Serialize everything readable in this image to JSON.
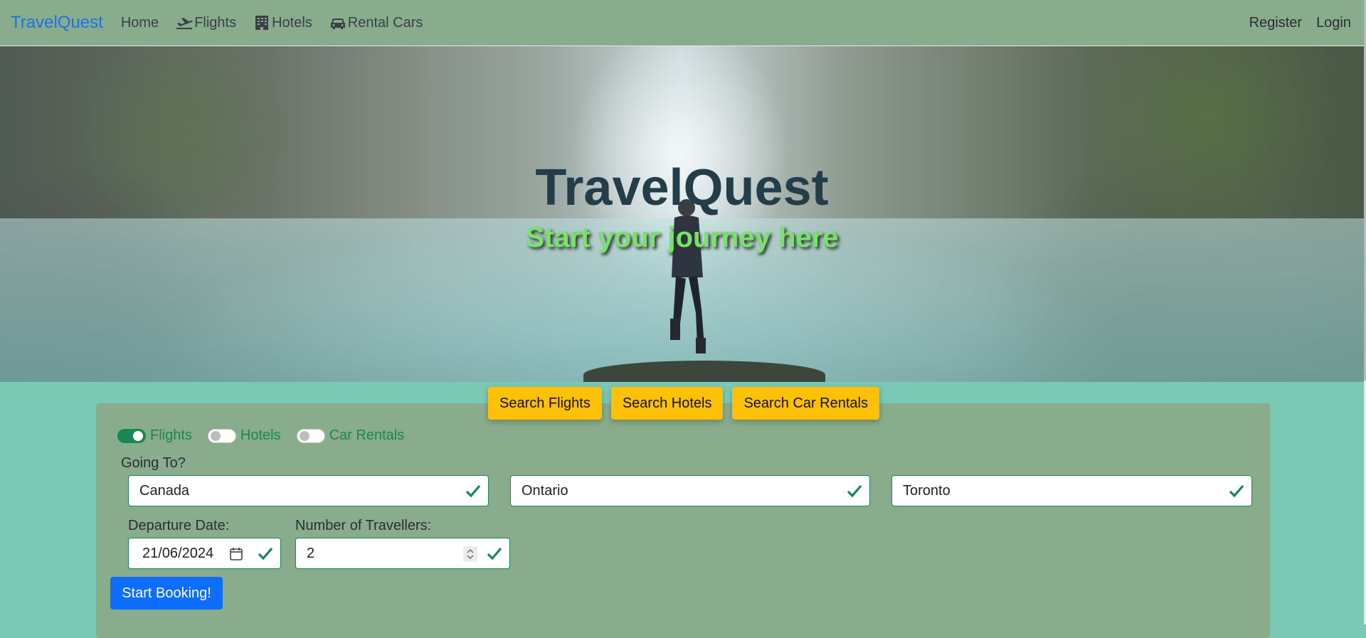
{
  "nav": {
    "brand": "TravelQuest",
    "links": [
      {
        "label": "Home",
        "icon": ""
      },
      {
        "label": "Flights",
        "icon": "plane-icon"
      },
      {
        "label": "Hotels",
        "icon": "building-icon"
      },
      {
        "label": "Rental Cars",
        "icon": "car-icon"
      }
    ],
    "right": [
      {
        "label": "Register"
      },
      {
        "label": "Login"
      }
    ]
  },
  "hero": {
    "title": "TravelQuest",
    "subtitle": "Start your journey here"
  },
  "search_tabs": [
    "Search Flights",
    "Search Hotels",
    "Search Car Rentals"
  ],
  "booking": {
    "toggles": [
      {
        "label": "Flights",
        "on": true
      },
      {
        "label": "Hotels",
        "on": false
      },
      {
        "label": "Car Rentals",
        "on": false
      }
    ],
    "going_to_label": "Going To?",
    "country": "Canada",
    "province": "Ontario",
    "city": "Toronto",
    "departure_label": "Departure Date:",
    "departure_day": "21",
    "departure_month": "06",
    "departure_year": "2024",
    "travellers_label": "Number of Travellers:",
    "travellers": "2",
    "submit_label": "Start Booking!"
  },
  "colors": {
    "nav_bg": "#88ac8c",
    "page_bg": "#79c9b5",
    "brand": "#1a73e8",
    "tab_button": "#ffc107",
    "submit_button": "#0d6efd",
    "valid": "#198754",
    "subtitle": "#7be06e",
    "title": "#233e49"
  }
}
